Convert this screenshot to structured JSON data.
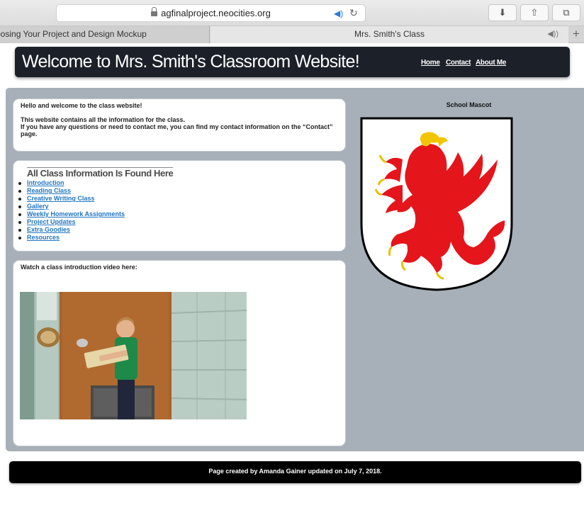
{
  "browser": {
    "url": "agfinalproject.neocities.org",
    "tabs": [
      {
        "label": "oosing Your Project and Design Mockup"
      },
      {
        "label": "Mrs. Smith's Class"
      }
    ],
    "buttons": {
      "download": "⬇",
      "share": "⇧",
      "tabs": "⧉",
      "new_tab": "+"
    }
  },
  "header": {
    "title": "Welcome to Mrs. Smith's Classroom Website!",
    "nav": [
      {
        "label": "Home"
      },
      {
        "label": "Contact"
      },
      {
        "label": "About Me"
      }
    ]
  },
  "intro": {
    "line1": "Hello and welcome to the class website!",
    "line2": "This website contains all the information for the class.",
    "line3": "If you have any questions or need to contact me, you can find my contact information on the “Contact” page."
  },
  "links": {
    "heading": "All Class Information Is Found Here",
    "items": [
      {
        "label": "Introduction"
      },
      {
        "label": "Reading Class"
      },
      {
        "label": "Creative Writing Class"
      },
      {
        "label": "Gallery"
      },
      {
        "label": "Weekly Homework Assignments"
      },
      {
        "label": "Project Updates"
      },
      {
        "label": "Extra Goodies"
      },
      {
        "label": "Resources"
      }
    ]
  },
  "video": {
    "label": "Watch a class introduction video here:"
  },
  "mascot": {
    "label": "School Mascot",
    "icon": "griffin-shield-icon",
    "colors": {
      "griffin": "#e4151b",
      "beak": "#f2c500",
      "shield_fill": "#ffffff"
    }
  },
  "footer": {
    "text": "Page created by Amanda Gainer updated on July 7, 2018."
  },
  "colors": {
    "header_bg": "#1b2029",
    "content_bg": "#a7b0b8",
    "link": "#2176c3",
    "footer_bg": "#000000"
  }
}
